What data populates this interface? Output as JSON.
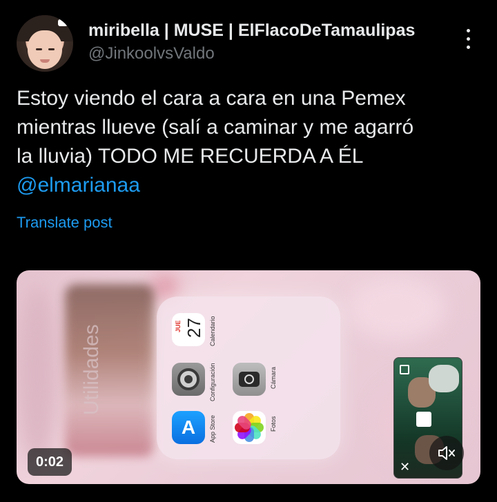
{
  "author": {
    "display_name": "miribella | MUSE | ElFlacoDeTamaulipas",
    "handle": "@JinkoolvsValdo"
  },
  "tweet": {
    "lines": [
      "Estoy viendo el cara a cara en una Pemex",
      "mientras llueve (salí a caminar y me agarró",
      "la lluvia) TODO ME RECUERDA A ÉL"
    ],
    "mention": "@elmarianaa",
    "translate_label": "Translate post"
  },
  "media": {
    "folder_label": "Utilidades",
    "apps": {
      "calendar": {
        "label": "Calendario",
        "month": "JUE",
        "day": "27"
      },
      "settings": {
        "label": "Configuración"
      },
      "camera": {
        "label": "Cámara"
      },
      "appstore": {
        "label": "App Store"
      },
      "photos": {
        "label": "Fotos"
      }
    },
    "duration": "0:02"
  },
  "colors": {
    "background": "#000000",
    "text": "#e7e9ea",
    "muted": "#71767b",
    "link": "#1d9bf0"
  },
  "icons": [
    "more-options-icon",
    "mute-icon",
    "close-icon",
    "popout-icon",
    "stop-icon"
  ]
}
